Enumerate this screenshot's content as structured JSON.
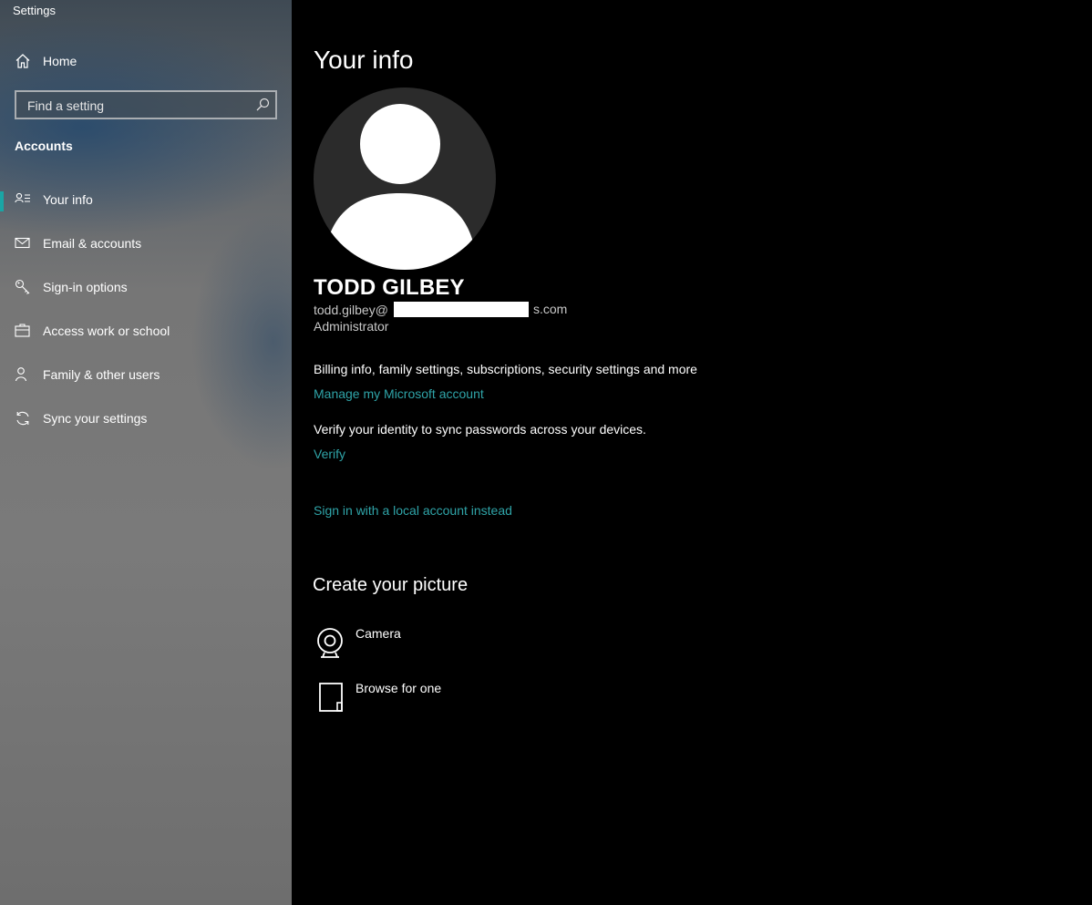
{
  "window": {
    "title": "Settings"
  },
  "sidebar": {
    "home": {
      "label": "Home",
      "icon": "home-icon"
    },
    "search": {
      "placeholder": "Find a setting",
      "value": "",
      "icon": "search-icon"
    },
    "section_heading": "Accounts",
    "items": [
      {
        "label": "Your info",
        "icon": "person-info-icon",
        "active": true
      },
      {
        "label": "Email & accounts",
        "icon": "mail-icon",
        "active": false
      },
      {
        "label": "Sign-in options",
        "icon": "key-icon",
        "active": false
      },
      {
        "label": "Access work or school",
        "icon": "briefcase-icon",
        "active": false
      },
      {
        "label": "Family & other users",
        "icon": "person-add-icon",
        "active": false
      },
      {
        "label": "Sync your settings",
        "icon": "sync-icon",
        "active": false
      }
    ]
  },
  "main": {
    "title": "Your info",
    "user": {
      "name": "TODD GILBEY",
      "email_prefix": "todd.gilbey@",
      "email_suffix": "s.com",
      "role": "Administrator"
    },
    "billing_text": "Billing info, family settings, subscriptions, security settings and more",
    "manage_link": "Manage my Microsoft account",
    "verify_text": "Verify your identity to sync passwords across your devices.",
    "verify_link": "Verify",
    "local_account_link": "Sign in with a local account instead",
    "create_picture": {
      "heading": "Create your picture",
      "options": [
        {
          "label": "Camera",
          "icon": "camera-icon"
        },
        {
          "label": "Browse for one",
          "icon": "browse-file-icon"
        }
      ]
    }
  },
  "colors": {
    "accent_link": "#2fa4a8",
    "active_indicator": "#1aa5a5",
    "main_background": "#000000"
  }
}
